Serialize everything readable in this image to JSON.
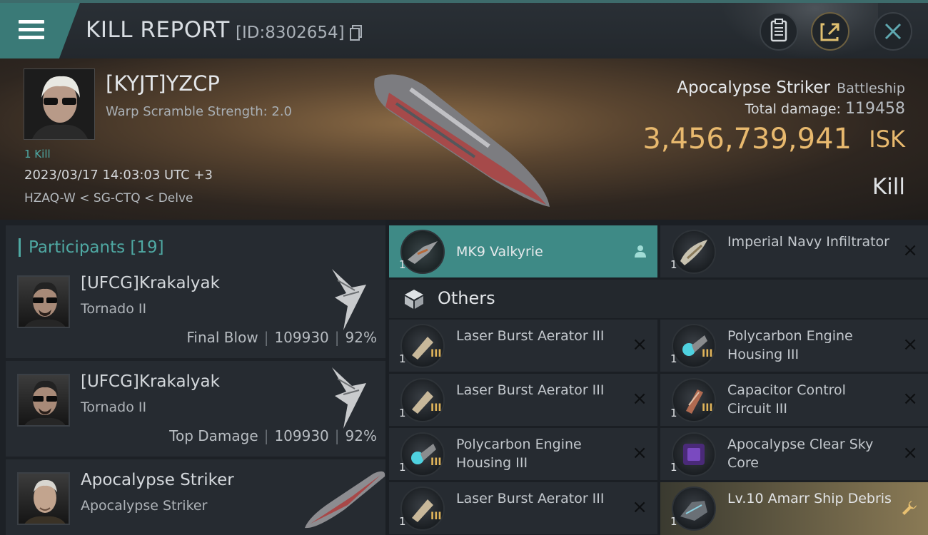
{
  "header": {
    "title": "KILL REPORT",
    "report_id": "[ID:8302654]",
    "icons": [
      "menu-icon",
      "copy-icon",
      "clipboard-icon",
      "share-icon",
      "close-icon"
    ]
  },
  "victim": {
    "name": "[KYJT]YZCP",
    "warp_scramble": "Warp Scramble Strength: 2.0",
    "kill_count": "1 Kill",
    "datetime": "2023/03/17 14:03:03 UTC +3",
    "location": "HZAQ-W < SG-CTQ < Delve",
    "ship_name": "Apocalypse Striker",
    "ship_class": "Battleship",
    "total_damage_label": "Total damage:",
    "total_damage": "119458",
    "isk_value": "3,456,739,941",
    "isk_unit": "ISK",
    "result": "Kill"
  },
  "participants": {
    "label": "Participants",
    "count": "[19]",
    "rows": [
      {
        "name": "[UFCG]Krakalyak",
        "ship": "Tornado II",
        "tag": "Final Blow",
        "damage": "109930",
        "percent": "92%"
      },
      {
        "name": "[UFCG]Krakalyak",
        "ship": "Tornado II",
        "tag": "Top Damage",
        "damage": "109930",
        "percent": "92%"
      },
      {
        "name": "Apocalypse Striker",
        "ship": "Apocalypse Striker"
      }
    ]
  },
  "items": {
    "top": [
      {
        "qty": "1",
        "name": "MK9  Valkyrie",
        "icon": "person-icon"
      },
      {
        "qty": "1",
        "name": "Imperial Navy Infiltrator",
        "icon": "close-icon"
      }
    ],
    "others_label": "Others",
    "others": [
      {
        "qty": "1",
        "name": "Laser Burst Aerator III",
        "tier": "III"
      },
      {
        "qty": "1",
        "name": "Polycarbon Engine Housing III",
        "tier": "III"
      },
      {
        "qty": "1",
        "name": "Laser Burst Aerator III",
        "tier": "III"
      },
      {
        "qty": "1",
        "name": "Capacitor Control Circuit III",
        "tier": "III"
      },
      {
        "qty": "1",
        "name": "Polycarbon Engine Housing III",
        "tier": "III"
      },
      {
        "qty": "1",
        "name": "Apocalypse Clear Sky Core"
      },
      {
        "qty": "1",
        "name": "Laser Burst Aerator III",
        "tier": "III"
      },
      {
        "qty": "1",
        "name": "Lv.10 Amarr Ship Debris",
        "icon": "wrench-icon"
      }
    ]
  },
  "colors": {
    "accent": "#3e8a86",
    "isk": "#e8b96e",
    "teal_text": "#4fa9a3"
  }
}
